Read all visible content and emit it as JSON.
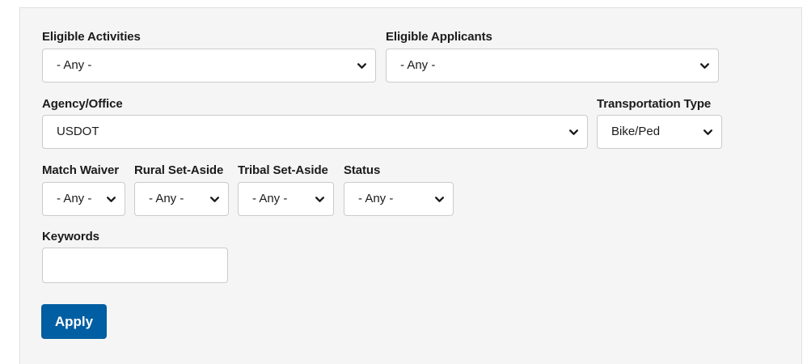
{
  "filters": {
    "eligible_activities": {
      "label": "Eligible Activities",
      "value": "- Any -"
    },
    "eligible_applicants": {
      "label": "Eligible Applicants",
      "value": "- Any -"
    },
    "agency_office": {
      "label": "Agency/Office",
      "value": "USDOT"
    },
    "transportation_type": {
      "label": "Transportation Type",
      "value": "Bike/Ped"
    },
    "match_waiver": {
      "label": "Match Waiver",
      "value": "- Any -"
    },
    "rural_set_aside": {
      "label": "Rural Set-Aside",
      "value": "- Any -"
    },
    "tribal_set_aside": {
      "label": "Tribal Set-Aside",
      "value": "- Any -"
    },
    "status": {
      "label": "Status",
      "value": "- Any -"
    },
    "keywords": {
      "label": "Keywords",
      "value": "",
      "placeholder": ""
    }
  },
  "actions": {
    "apply_label": "Apply"
  },
  "colors": {
    "panel_background": "#f5f5f5",
    "button_background": "#005ea2",
    "button_text": "#ffffff",
    "border": "#c9cbcd"
  },
  "icons": {
    "dropdown": "chevron-down-icon"
  }
}
